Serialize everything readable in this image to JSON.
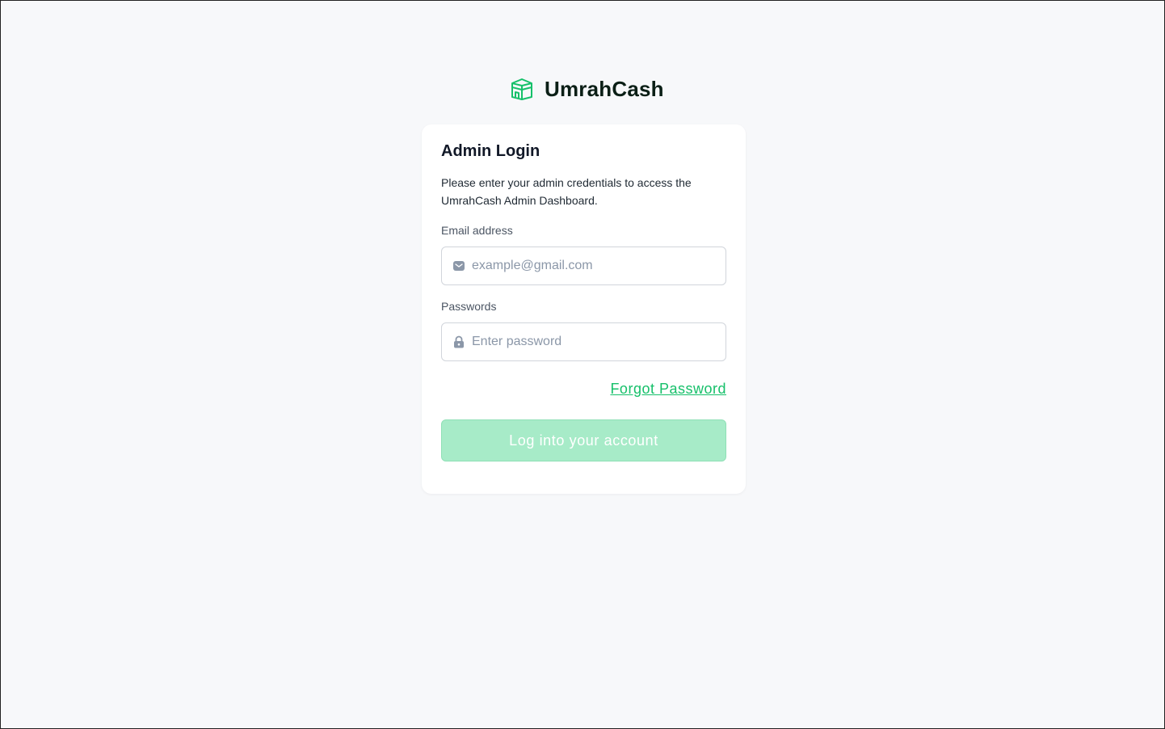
{
  "brand": {
    "name": "UmrahCash",
    "icon": "kaaba-icon",
    "color": "#16c06a"
  },
  "login": {
    "title": "Admin Login",
    "description": "Please enter your admin credentials to access the UmrahCash Admin Dashboard.",
    "email": {
      "label": "Email address",
      "placeholder": "example@gmail.com",
      "value": "",
      "icon": "envelope-icon"
    },
    "password": {
      "label": "Passwords",
      "placeholder": "Enter password",
      "value": "",
      "icon": "lock-icon"
    },
    "forgot_label": "Forgot Password",
    "submit_label": "Log into your account"
  },
  "colors": {
    "accent": "#16c06a",
    "button_disabled": "#a7ebc8",
    "background": "#f7f8fa"
  }
}
